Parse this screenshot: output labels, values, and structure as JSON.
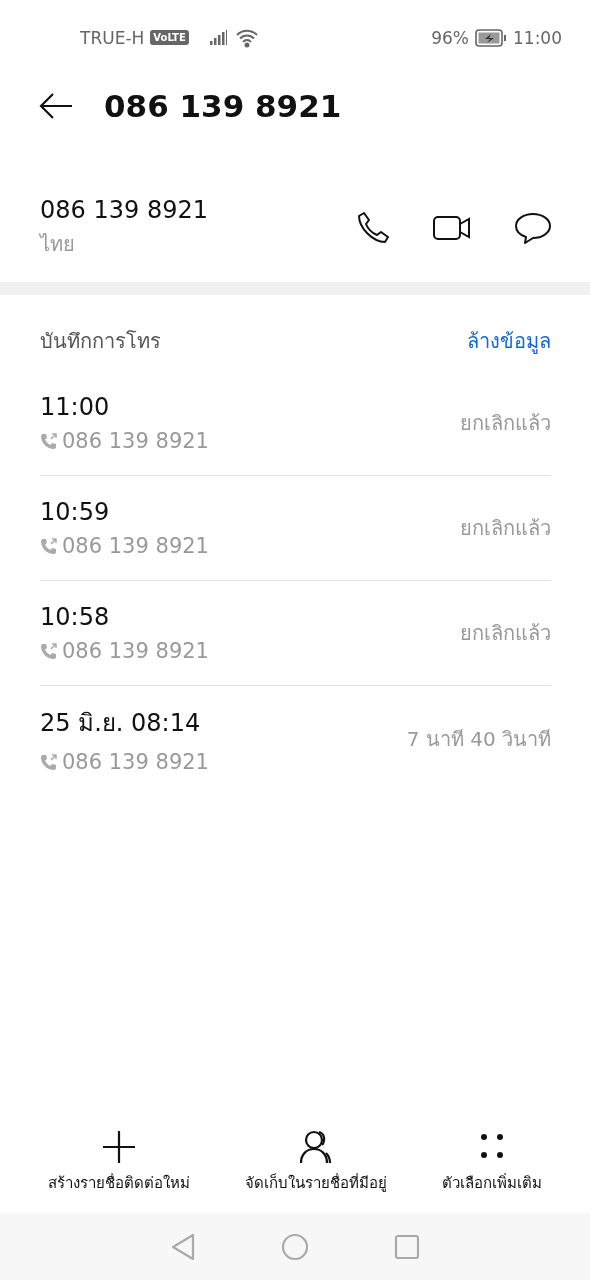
{
  "status_bar": {
    "carrier": "TRUE-H",
    "network_badge": "VoLTE",
    "battery": "96%",
    "time": "11:00"
  },
  "header": {
    "title": "086 139 8921"
  },
  "contact": {
    "number": "086 139 8921",
    "region": "ไทย"
  },
  "call_log": {
    "title": "บันทึกการโทร",
    "clear_link": "ล้างข้อมูล",
    "entries": [
      {
        "time": "11:00",
        "number": "086 139 8921",
        "detail": "ยกเลิกแล้ว"
      },
      {
        "time": "10:59",
        "number": "086 139 8921",
        "detail": "ยกเลิกแล้ว"
      },
      {
        "time": "10:58",
        "number": "086 139 8921",
        "detail": "ยกเลิกแล้ว"
      },
      {
        "time": "25 มิ.ย. 08:14",
        "number": "086 139 8921",
        "detail": "7 นาที 40 วินาที"
      }
    ]
  },
  "actions": [
    {
      "kind": "add",
      "label": "สร้างรายชื่อติดต่อใหม่"
    },
    {
      "kind": "person",
      "label": "จัดเก็บในรายชื่อที่มีอยู่"
    },
    {
      "kind": "more",
      "label": "ตัวเลือกเพิ่มเติม"
    }
  ]
}
